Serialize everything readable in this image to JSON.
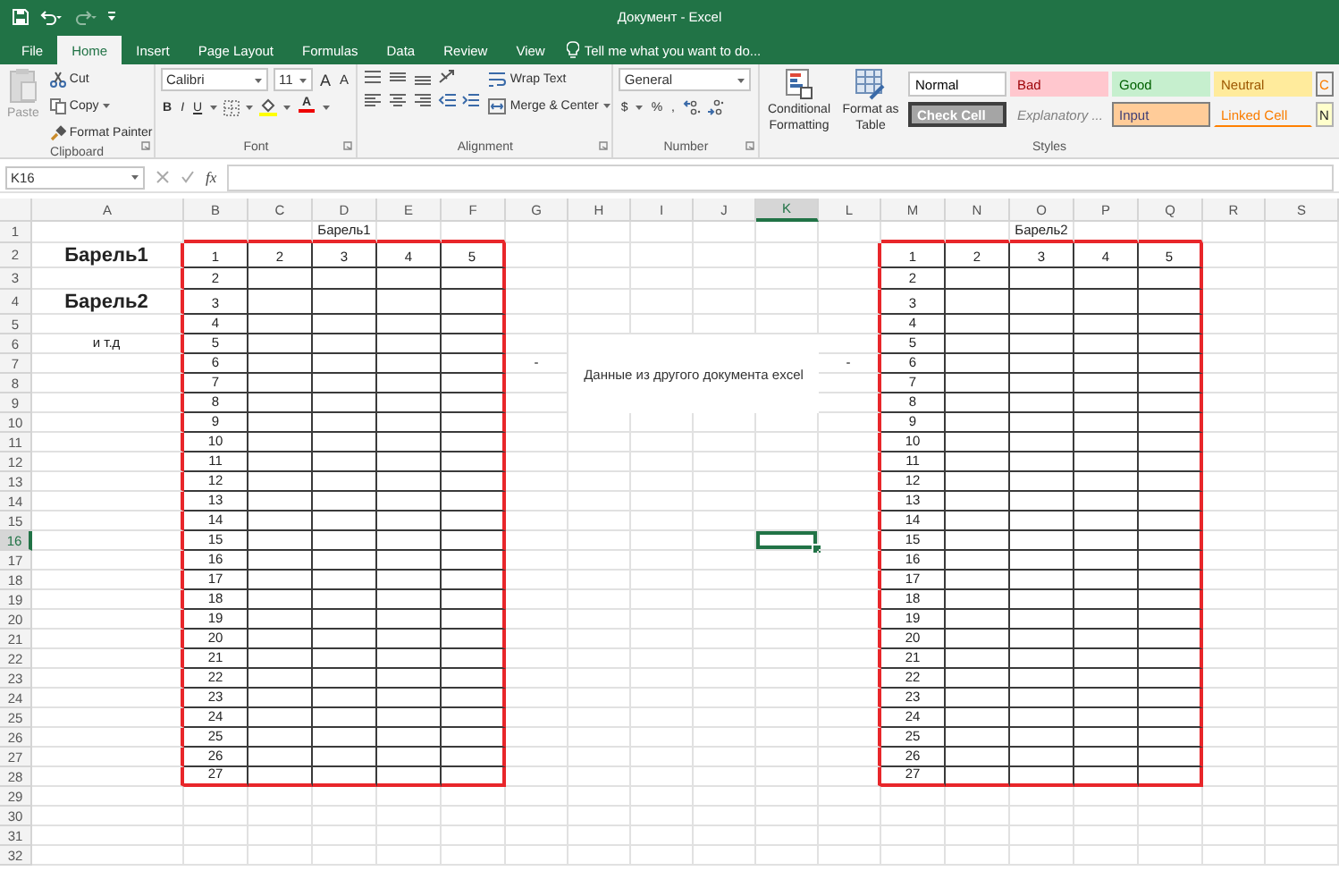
{
  "window": {
    "title": "Документ - Excel"
  },
  "tabs": [
    {
      "label": "File",
      "selected": false
    },
    {
      "label": "Home",
      "selected": true
    },
    {
      "label": "Insert",
      "selected": false
    },
    {
      "label": "Page Layout",
      "selected": false
    },
    {
      "label": "Formulas",
      "selected": false
    },
    {
      "label": "Data",
      "selected": false
    },
    {
      "label": "Review",
      "selected": false
    },
    {
      "label": "View",
      "selected": false
    }
  ],
  "tell_me": "Tell me what you want to do...",
  "clipboard": {
    "label": "Clipboard",
    "paste": "Paste",
    "cut": "Cut",
    "copy": "Copy",
    "format_painter": "Format Painter"
  },
  "font": {
    "label": "Font",
    "family": "Calibri",
    "size": "11",
    "grow": "A",
    "shrink": "A",
    "bold": "B",
    "italic": "I",
    "underline": "U",
    "font_color": "A"
  },
  "alignment": {
    "label": "Alignment",
    "wrap_text": "Wrap Text",
    "merge_center": "Merge & Center"
  },
  "number": {
    "label": "Number",
    "format": "General",
    "currency": "$",
    "percent": "%",
    "comma": ","
  },
  "styles": {
    "label": "Styles",
    "conditional_formatting": "Conditional Formatting",
    "format_as_table": "Format as Table",
    "cell_styles": [
      {
        "name": "Normal",
        "kind": "normal"
      },
      {
        "name": "Bad",
        "kind": "bad"
      },
      {
        "name": "Good",
        "kind": "good"
      },
      {
        "name": "Neutral",
        "kind": "neutral"
      },
      {
        "name": "C",
        "kind": "calculation"
      },
      {
        "name": "Check Cell",
        "kind": "check"
      },
      {
        "name": "Explanatory ...",
        "kind": "explanatory"
      },
      {
        "name": "Input",
        "kind": "input"
      },
      {
        "name": "Linked Cell",
        "kind": "linked"
      },
      {
        "name": "N",
        "kind": "note"
      }
    ]
  },
  "formula_bar": {
    "name_box": "K16",
    "fx": "fx"
  },
  "sheet": {
    "columns": [
      {
        "label": "A",
        "selected": false
      },
      {
        "label": "B",
        "selected": false
      },
      {
        "label": "C",
        "selected": false
      },
      {
        "label": "D",
        "selected": false
      },
      {
        "label": "E",
        "selected": false
      },
      {
        "label": "F",
        "selected": false
      },
      {
        "label": "G",
        "selected": false
      },
      {
        "label": "H",
        "selected": false
      },
      {
        "label": "I",
        "selected": false
      },
      {
        "label": "J",
        "selected": false
      },
      {
        "label": "K",
        "selected": true
      },
      {
        "label": "L",
        "selected": false
      },
      {
        "label": "M",
        "selected": false
      },
      {
        "label": "N",
        "selected": false
      },
      {
        "label": "O",
        "selected": false
      },
      {
        "label": "P",
        "selected": false
      },
      {
        "label": "Q",
        "selected": false
      },
      {
        "label": "R",
        "selected": false
      },
      {
        "label": "S",
        "selected": false
      }
    ],
    "rows": [
      {
        "header": "1",
        "selected": false,
        "cells": {
          "D": {
            "text": "Барель1",
            "kind": "text"
          },
          "O": {
            "text": "Барель2",
            "kind": "text"
          }
        }
      },
      {
        "header": "2",
        "selected": false,
        "cells": {
          "A": {
            "text": "Барель1",
            "kind": "heading"
          },
          "B": {
            "text": "1",
            "kind": "text"
          },
          "C": {
            "text": "2",
            "kind": "text"
          },
          "D": {
            "text": "3",
            "kind": "text"
          },
          "E": {
            "text": "4",
            "kind": "text"
          },
          "F": {
            "text": "5",
            "kind": "text"
          },
          "M": {
            "text": "1",
            "kind": "text"
          },
          "N": {
            "text": "2",
            "kind": "text"
          },
          "O": {
            "text": "3",
            "kind": "text"
          },
          "P": {
            "text": "4",
            "kind": "text"
          },
          "Q": {
            "text": "5",
            "kind": "text"
          }
        }
      },
      {
        "header": "3",
        "selected": false,
        "cells": {
          "B": {
            "text": "2",
            "kind": "text"
          },
          "M": {
            "text": "2",
            "kind": "text"
          }
        }
      },
      {
        "header": "4",
        "selected": false,
        "cells": {
          "A": {
            "text": "Барель2",
            "kind": "heading"
          },
          "B": {
            "text": "3",
            "kind": "text"
          },
          "M": {
            "text": "3",
            "kind": "text"
          }
        }
      },
      {
        "header": "5",
        "selected": false,
        "cells": {
          "B": {
            "text": "4",
            "kind": "text"
          },
          "M": {
            "text": "4",
            "kind": "text"
          }
        }
      },
      {
        "header": "6",
        "selected": false,
        "cells": {
          "A": {
            "text": "и т.д",
            "kind": "text"
          },
          "B": {
            "text": "5",
            "kind": "text"
          },
          "M": {
            "text": "5",
            "kind": "text"
          }
        }
      },
      {
        "header": "7",
        "selected": false,
        "cells": {
          "B": {
            "text": "6",
            "kind": "text"
          },
          "G": {
            "text": "-",
            "kind": "text"
          },
          "L": {
            "text": "-",
            "kind": "text"
          },
          "M": {
            "text": "6",
            "kind": "text"
          }
        }
      },
      {
        "header": "8",
        "selected": false,
        "cells": {
          "B": {
            "text": "7",
            "kind": "text"
          },
          "M": {
            "text": "7",
            "kind": "text"
          }
        }
      },
      {
        "header": "9",
        "selected": false,
        "cells": {
          "B": {
            "text": "8",
            "kind": "text"
          },
          "M": {
            "text": "8",
            "kind": "text"
          }
        }
      },
      {
        "header": "10",
        "selected": false,
        "cells": {
          "B": {
            "text": "9",
            "kind": "text"
          },
          "M": {
            "text": "9",
            "kind": "text"
          }
        }
      },
      {
        "header": "11",
        "selected": false,
        "cells": {
          "B": {
            "text": "10",
            "kind": "text"
          },
          "M": {
            "text": "10",
            "kind": "text"
          }
        }
      },
      {
        "header": "12",
        "selected": false,
        "cells": {
          "B": {
            "text": "11",
            "kind": "text"
          },
          "M": {
            "text": "11",
            "kind": "text"
          }
        }
      },
      {
        "header": "13",
        "selected": false,
        "cells": {
          "B": {
            "text": "12",
            "kind": "text"
          },
          "M": {
            "text": "12",
            "kind": "text"
          }
        }
      },
      {
        "header": "14",
        "selected": false,
        "cells": {
          "B": {
            "text": "13",
            "kind": "text"
          },
          "M": {
            "text": "13",
            "kind": "text"
          }
        }
      },
      {
        "header": "15",
        "selected": false,
        "cells": {
          "B": {
            "text": "14",
            "kind": "text"
          },
          "M": {
            "text": "14",
            "kind": "text"
          }
        }
      },
      {
        "header": "16",
        "selected": true,
        "cells": {
          "B": {
            "text": "15",
            "kind": "text"
          },
          "M": {
            "text": "15",
            "kind": "text"
          }
        }
      },
      {
        "header": "17",
        "selected": false,
        "cells": {
          "B": {
            "text": "16",
            "kind": "text"
          },
          "M": {
            "text": "16",
            "kind": "text"
          }
        }
      },
      {
        "header": "18",
        "selected": false,
        "cells": {
          "B": {
            "text": "17",
            "kind": "text"
          },
          "M": {
            "text": "17",
            "kind": "text"
          }
        }
      },
      {
        "header": "19",
        "selected": false,
        "cells": {
          "B": {
            "text": "18",
            "kind": "text"
          },
          "M": {
            "text": "18",
            "kind": "text"
          }
        }
      },
      {
        "header": "20",
        "selected": false,
        "cells": {
          "B": {
            "text": "19",
            "kind": "text"
          },
          "M": {
            "text": "19",
            "kind": "text"
          }
        }
      },
      {
        "header": "21",
        "selected": false,
        "cells": {
          "B": {
            "text": "20",
            "kind": "text"
          },
          "M": {
            "text": "20",
            "kind": "text"
          }
        }
      },
      {
        "header": "22",
        "selected": false,
        "cells": {
          "B": {
            "text": "21",
            "kind": "text"
          },
          "M": {
            "text": "21",
            "kind": "text"
          }
        }
      },
      {
        "header": "23",
        "selected": false,
        "cells": {
          "B": {
            "text": "22",
            "kind": "text"
          },
          "M": {
            "text": "22",
            "kind": "text"
          }
        }
      },
      {
        "header": "24",
        "selected": false,
        "cells": {
          "B": {
            "text": "23",
            "kind": "text"
          },
          "M": {
            "text": "23",
            "kind": "text"
          }
        }
      },
      {
        "header": "25",
        "selected": false,
        "cells": {
          "B": {
            "text": "24",
            "kind": "text"
          },
          "M": {
            "text": "24",
            "kind": "text"
          }
        }
      },
      {
        "header": "26",
        "selected": false,
        "cells": {
          "B": {
            "text": "25",
            "kind": "text"
          },
          "M": {
            "text": "25",
            "kind": "text"
          }
        }
      },
      {
        "header": "27",
        "selected": false,
        "cells": {
          "B": {
            "text": "26",
            "kind": "text"
          },
          "M": {
            "text": "26",
            "kind": "text"
          }
        }
      },
      {
        "header": "28",
        "selected": false,
        "cells": {
          "B": {
            "text": "27",
            "kind": "text"
          },
          "M": {
            "text": "27",
            "kind": "text"
          }
        }
      },
      {
        "header": "29",
        "selected": false
      },
      {
        "header": "30",
        "selected": false
      },
      {
        "header": "31",
        "selected": false
      },
      {
        "header": "32",
        "selected": false
      }
    ],
    "text_box": {
      "text": "Данные из другого документа excel"
    }
  }
}
